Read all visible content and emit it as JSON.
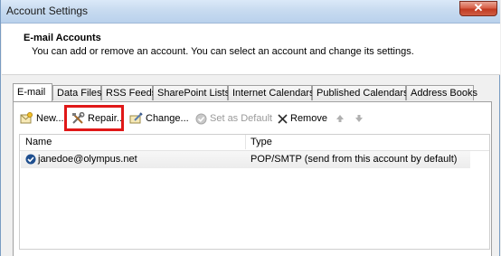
{
  "window": {
    "title": "Account Settings",
    "close_label": "✕"
  },
  "header": {
    "title": "E-mail Accounts",
    "description": "You can add or remove an account. You can select an account and change its settings."
  },
  "tabs": [
    {
      "label": "E-mail",
      "active": true
    },
    {
      "label": "Data Files"
    },
    {
      "label": "RSS Feeds"
    },
    {
      "label": "SharePoint Lists"
    },
    {
      "label": "Internet Calendars"
    },
    {
      "label": "Published Calendars"
    },
    {
      "label": "Address Books"
    }
  ],
  "toolbar": {
    "new_label": "New...",
    "repair_label": "Repair...",
    "change_label": "Change...",
    "set_default_label": "Set as Default",
    "remove_label": "Remove"
  },
  "accounts_table": {
    "columns": [
      "Name",
      "Type"
    ],
    "rows": [
      {
        "name": "janedoe@olympus.net",
        "type": "POP/SMTP (send from this account by default)",
        "is_default": true
      }
    ]
  },
  "colors": {
    "highlight": "#e01818",
    "titlebar": "#c8dbf0",
    "close_button": "#c13b22"
  }
}
